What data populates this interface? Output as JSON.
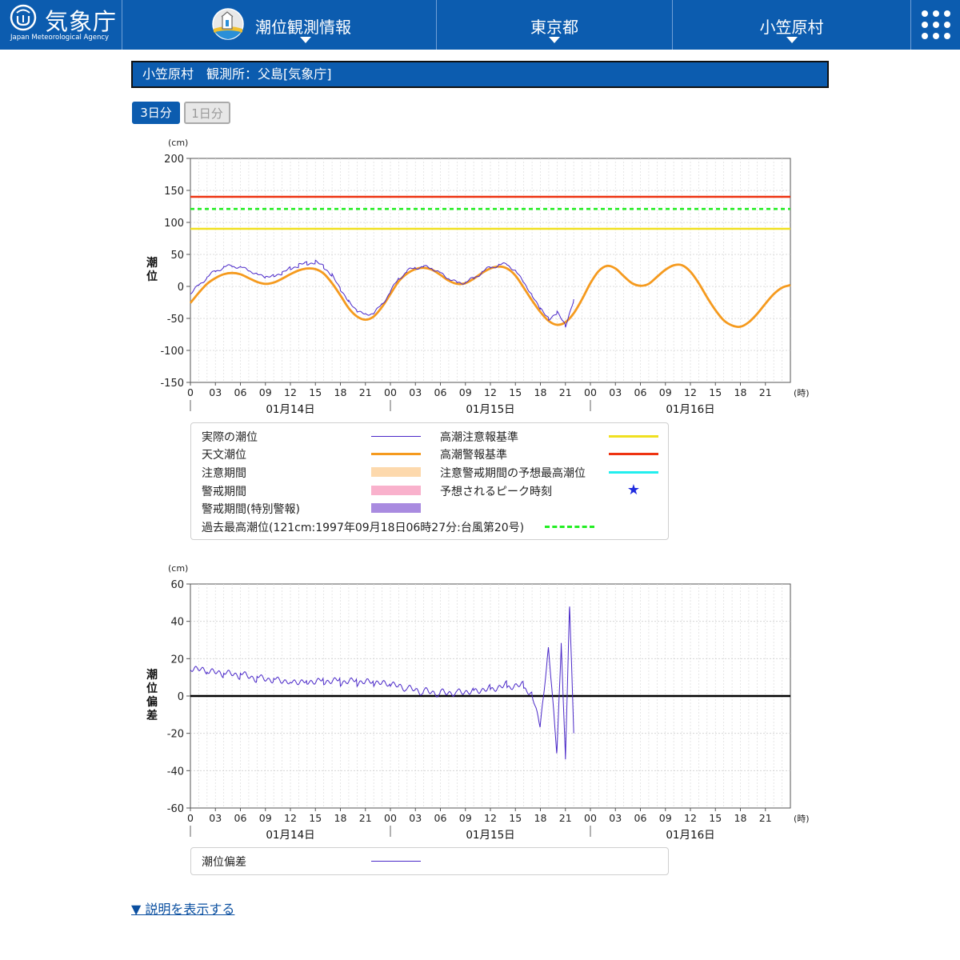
{
  "header": {
    "logo_kanji": "気象庁",
    "logo_en": "Japan Meteorological Agency",
    "nav": [
      {
        "label": "潮位観測情報"
      },
      {
        "label": "東京都"
      },
      {
        "label": "小笠原村"
      }
    ],
    "menu_icon": "grid-menu-icon"
  },
  "station_title": "小笠原村　観測所：父島[気象庁]",
  "period_tabs": [
    {
      "label": "3日分",
      "active": true
    },
    {
      "label": "1日分",
      "active": false
    }
  ],
  "chart_data": [
    {
      "type": "line",
      "unit_label": "(cm)",
      "ylabel": "潮位",
      "xlabel": "(時)",
      "ylim": [
        -150,
        200
      ],
      "yticks": [
        -150,
        -100,
        -50,
        0,
        50,
        100,
        150,
        200
      ],
      "xlim": [
        0,
        72
      ],
      "hour_ticks": [
        "0",
        "03",
        "06",
        "09",
        "12",
        "15",
        "18",
        "21",
        "00",
        "03",
        "06",
        "09",
        "12",
        "15",
        "18",
        "21",
        "00",
        "03",
        "06",
        "09",
        "12",
        "15",
        "18",
        "21"
      ],
      "date_labels": [
        "01月14日",
        "01月15日",
        "01月16日"
      ],
      "grid": true,
      "reference_lines": [
        {
          "name": "高潮警報基準",
          "value": 140,
          "color": "#ee3311",
          "style": "solid"
        },
        {
          "name": "過去最高潮位",
          "value": 121,
          "color": "#22ee22",
          "style": "dashed"
        },
        {
          "name": "高潮注意報基準",
          "value": 90,
          "color": "#f0e020",
          "style": "solid"
        }
      ],
      "series": [
        {
          "name": "天文潮位",
          "color": "#f59a1e",
          "x": [
            0,
            1,
            2,
            3,
            4,
            5,
            6,
            7,
            8,
            9,
            10,
            11,
            12,
            13,
            14,
            15,
            16,
            17,
            18,
            19,
            20,
            21,
            22,
            23,
            24,
            25,
            26,
            27,
            28,
            29,
            30,
            31,
            32,
            33,
            34,
            35,
            36,
            37,
            38,
            39,
            40,
            41,
            42,
            43,
            44,
            45,
            46,
            47,
            48,
            49,
            50,
            51,
            52,
            53,
            54,
            55,
            56,
            57,
            58,
            59,
            60,
            61,
            62,
            63,
            64,
            65,
            66,
            67,
            68,
            69,
            70,
            71,
            72
          ],
          "values": [
            -26,
            -10,
            4,
            13,
            19,
            21,
            19,
            13,
            7,
            4,
            6,
            12,
            19,
            25,
            28,
            27,
            20,
            5,
            -14,
            -34,
            -47,
            -52,
            -47,
            -32,
            -12,
            8,
            20,
            27,
            29,
            26,
            18,
            9,
            4,
            5,
            12,
            21,
            28,
            31,
            28,
            17,
            -2,
            -22,
            -40,
            -54,
            -60,
            -56,
            -42,
            -20,
            5,
            24,
            32,
            28,
            16,
            5,
            1,
            4,
            15,
            26,
            33,
            33,
            23,
            5,
            -17,
            -37,
            -53,
            -61,
            -63,
            -56,
            -43,
            -27,
            -12,
            -2,
            2
          ]
        },
        {
          "name": "実際の潮位",
          "color": "#4a28c8",
          "x": [
            0,
            1,
            2,
            3,
            4,
            5,
            6,
            7,
            8,
            9,
            10,
            11,
            12,
            13,
            14,
            15,
            16,
            17,
            18,
            19,
            20,
            21,
            22,
            23,
            24,
            25,
            26,
            27,
            28,
            29,
            30,
            31,
            32,
            33,
            34,
            35,
            36,
            37,
            38,
            39,
            40,
            41,
            42,
            43,
            44,
            45,
            46
          ],
          "values": [
            -12,
            2,
            14,
            24,
            30,
            32,
            30,
            25,
            19,
            15,
            16,
            21,
            28,
            33,
            36,
            38,
            31,
            17,
            -4,
            -24,
            -38,
            -44,
            -42,
            -28,
            -8,
            12,
            24,
            29,
            31,
            28,
            21,
            12,
            6,
            6,
            13,
            22,
            30,
            33,
            35,
            24,
            7,
            -15,
            -34,
            -52,
            -40,
            -62,
            -20
          ]
        }
      ]
    },
    {
      "type": "line",
      "unit_label": "(cm)",
      "ylabel": "潮位偏差",
      "xlabel": "(時)",
      "ylim": [
        -60,
        60
      ],
      "yticks": [
        -60,
        -40,
        -20,
        0,
        20,
        40,
        60
      ],
      "xlim": [
        0,
        72
      ],
      "hour_ticks": [
        "0",
        "03",
        "06",
        "09",
        "12",
        "15",
        "18",
        "21",
        "00",
        "03",
        "06",
        "09",
        "12",
        "15",
        "18",
        "21",
        "00",
        "03",
        "06",
        "09",
        "12",
        "15",
        "18",
        "21"
      ],
      "date_labels": [
        "01月14日",
        "01月15日",
        "01月16日"
      ],
      "grid": true,
      "zero_line": true,
      "series": [
        {
          "name": "潮位偏差",
          "color": "#4a28c8",
          "x": [
            0,
            2,
            4,
            6,
            8,
            10,
            12,
            14,
            16,
            18,
            20,
            22,
            24,
            26,
            28,
            30,
            32,
            34,
            36,
            38,
            40,
            41,
            42,
            43,
            44,
            44.5,
            45,
            45.5,
            46
          ],
          "values": [
            14,
            12,
            11,
            11,
            10,
            10,
            9,
            9,
            9,
            8,
            7,
            6,
            5,
            3,
            2,
            2,
            3,
            4,
            5,
            6,
            5,
            0,
            -15,
            25,
            -30,
            26,
            -32,
            50,
            -20
          ]
        }
      ]
    }
  ],
  "legend_top": {
    "items": [
      {
        "label": "実際の潮位",
        "kind": "line",
        "color": "#4a28c8"
      },
      {
        "label": "天文潮位",
        "kind": "thick",
        "color": "#f59a1e"
      },
      {
        "label": "注意期間",
        "kind": "band",
        "color": "#fdd9ad"
      },
      {
        "label": "警戒期間",
        "kind": "band",
        "color": "#f9b1cc"
      },
      {
        "label": "警戒期間(特別警報)",
        "kind": "band",
        "color": "#a98be0"
      },
      {
        "label": "高潮注意報基準",
        "kind": "thick",
        "color": "#f0e020"
      },
      {
        "label": "高潮警報基準",
        "kind": "thick",
        "color": "#ee3311"
      },
      {
        "label": "注意警戒期間の予想最高潮位",
        "kind": "thick",
        "color": "#22eeee"
      },
      {
        "label": "予想されるピーク時刻",
        "kind": "star",
        "color": "#1e2adf",
        "symbol": "★"
      },
      {
        "label": "過去最高潮位(121cm:1997年09月18日06時27分:台風第20号)",
        "kind": "dashed",
        "color": "#22ee22"
      }
    ]
  },
  "legend_bottom": {
    "items": [
      {
        "label": "潮位偏差",
        "kind": "line",
        "color": "#4a28c8"
      }
    ]
  },
  "explain_link": "▼ 説明を表示する"
}
